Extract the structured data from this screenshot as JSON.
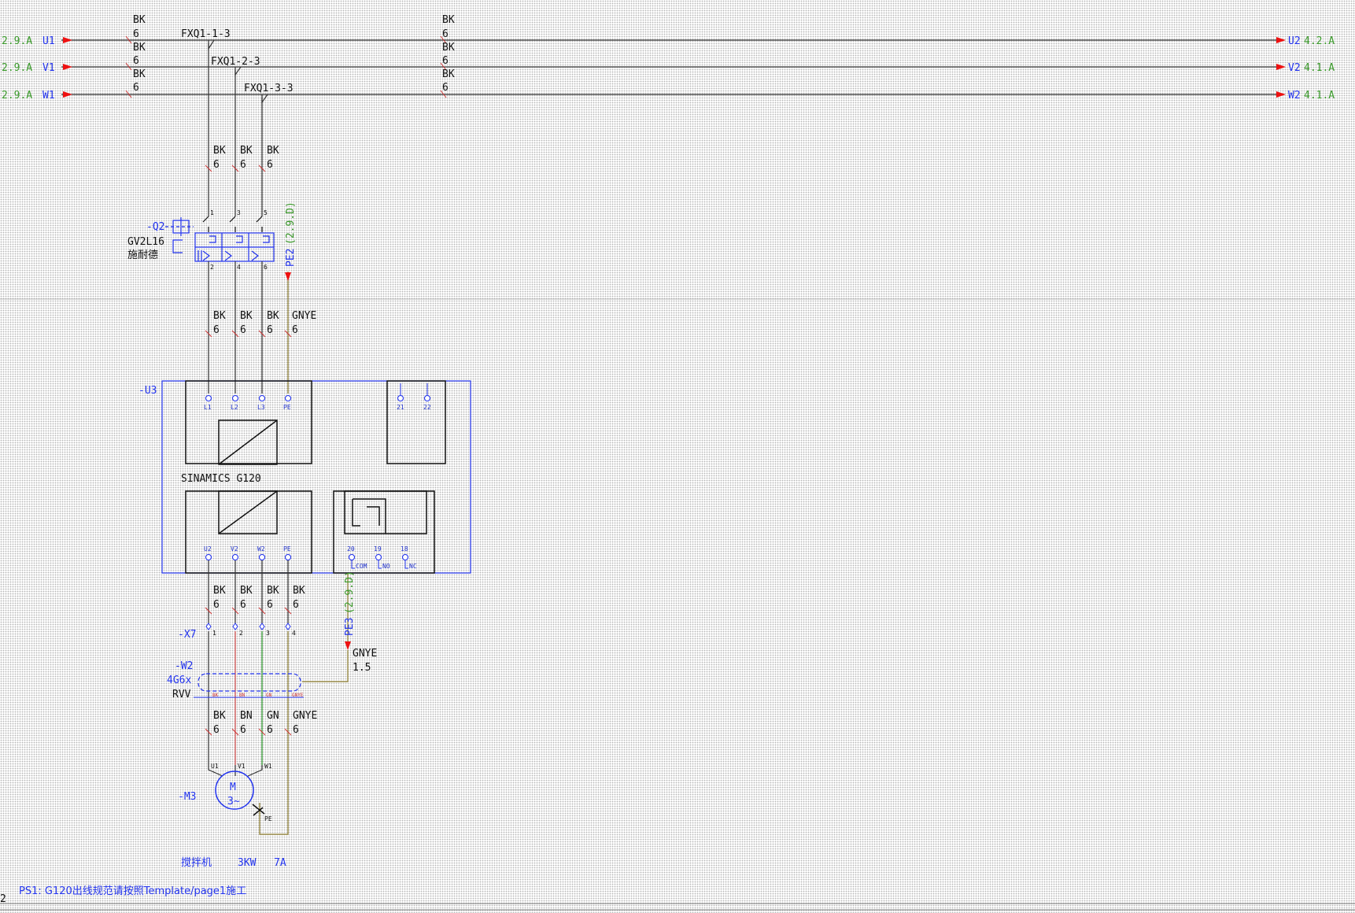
{
  "offpage": {
    "in": [
      {
        "ref": "2.9.A",
        "sig": "U1"
      },
      {
        "ref": "2.9.A",
        "sig": "V1"
      },
      {
        "ref": "2.9.A",
        "sig": "W1"
      }
    ],
    "out": [
      {
        "sig": "U2",
        "ref": "4.2.A"
      },
      {
        "sig": "V2",
        "ref": "4.1.A"
      },
      {
        "sig": "W2",
        "ref": "4.1.A"
      }
    ]
  },
  "wire": {
    "color": "BK",
    "size": "6"
  },
  "fxq": [
    "FXQ1-1-3",
    "FXQ1-2-3",
    "FXQ1-3-3"
  ],
  "q2": {
    "tag": "-Q2",
    "model": "GV2L16",
    "maker": "施耐德",
    "pins_top": [
      "1",
      "3",
      "5"
    ],
    "pins_bottom": [
      "2",
      "4",
      "6"
    ],
    "pe_tag": "PE2",
    "pe_ref": "(2.9.D)"
  },
  "gnye": {
    "color": "GNYE",
    "size": "6"
  },
  "u3": {
    "tag": "-U3",
    "name": "SINAMICS G120",
    "in_terms": [
      "L1",
      "L2",
      "L3",
      "PE"
    ],
    "brake_terms": [
      "21",
      "22"
    ],
    "out_terms": [
      "U2",
      "V2",
      "W2",
      "PE"
    ],
    "relay_terms": [
      "20",
      "19",
      "18"
    ],
    "relay_labels": [
      "COM",
      "NO",
      "NC"
    ]
  },
  "x7": {
    "tag": "-X7",
    "pins": [
      "1",
      "2",
      "3",
      "4"
    ],
    "pe_tag": "PE3",
    "pe_ref": "(2.9.D)"
  },
  "shield": {
    "color": "GNYE",
    "size": "1.5"
  },
  "w2": {
    "tag": "-W2",
    "spec": "4G6x",
    "type": "RVV",
    "cores": [
      "BK",
      "BN",
      "GN",
      "GNYE"
    ],
    "core_sizes": [
      "6",
      "6",
      "6",
      "6"
    ]
  },
  "m3": {
    "tag": "-M3",
    "symbol": "M",
    "phase": "3~",
    "terms": [
      "U1",
      "V1",
      "W1"
    ],
    "pe": "PE"
  },
  "load": {
    "name": "搅拌机",
    "power": "3KW",
    "current": "7A"
  },
  "note": "PS1: G120出线规范请按照Template/page1施工",
  "page_no": "2"
}
